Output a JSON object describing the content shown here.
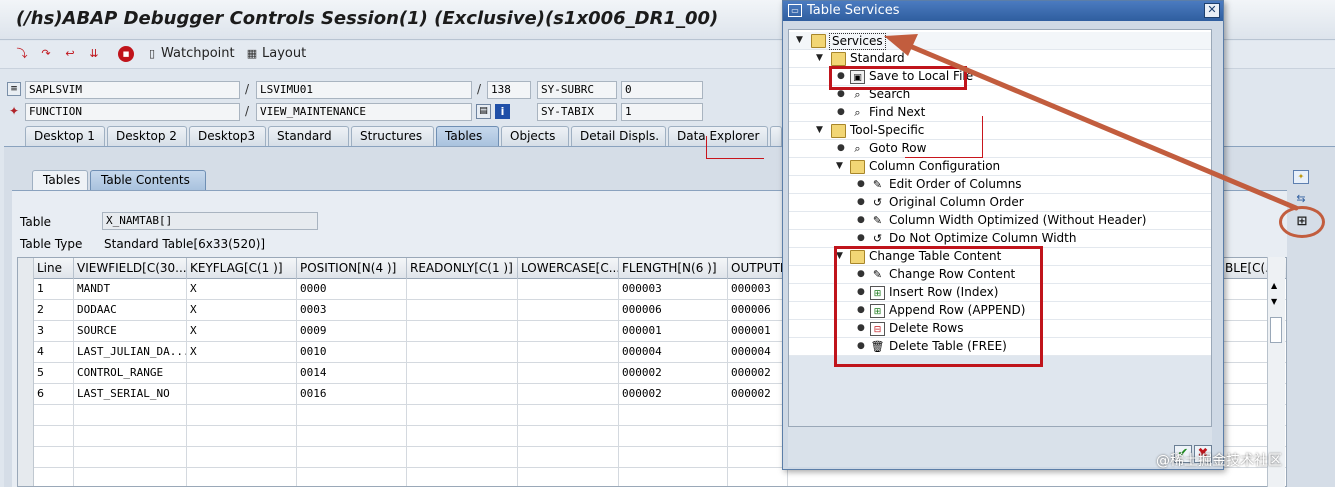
{
  "window": {
    "title": "(/hs)ABAP Debugger Controls Session(1)  (Exclusive)(s1x006_DR1_00)"
  },
  "toolbar": {
    "watchpoint_label": "Watchpoint",
    "layout_label": "Layout"
  },
  "info_fields": {
    "row1": {
      "program": "SAPLSVIM",
      "include": "LSVIMU01",
      "line": "138",
      "sy_label": "SY-SUBRC",
      "sy_value": "0"
    },
    "row2": {
      "type": "FUNCTION",
      "name": "VIEW_MAINTENANCE",
      "sy_label": "SY-TABIX",
      "sy_value": "1"
    }
  },
  "main_tabs": [
    "Desktop 1",
    "Desktop 2",
    "Desktop3",
    "Standard",
    "Structures",
    "Tables",
    "Objects",
    "Detail Displs.",
    "Data Explorer"
  ],
  "sub_tabs": [
    "Tables",
    "Table Contents"
  ],
  "table_info": {
    "table_label": "Table",
    "table_value": "X_NAMTAB[]",
    "type_label": "Table Type",
    "type_value": "Standard Table[6x33(520)]"
  },
  "grid": {
    "columns": [
      "Line",
      "VIEWFIELD[C(30...",
      "KEYFLAG[C(1 )]",
      "POSITION[N(4 )]",
      "READONLY[C(1 )]",
      "LOWERCASE[C...",
      "FLENGTH[N(6 )]",
      "OUTPUTL"
    ],
    "last_column": "BLE[C(...",
    "rows": [
      [
        "1",
        "MANDT",
        "X",
        "0000",
        "",
        "",
        "000003",
        "000003"
      ],
      [
        "2",
        "DODAAC",
        "X",
        "0003",
        "",
        "",
        "000006",
        "000006"
      ],
      [
        "3",
        "SOURCE",
        "X",
        "0009",
        "",
        "",
        "000001",
        "000001"
      ],
      [
        "4",
        "LAST_JULIAN_DA...",
        "X",
        "0010",
        "",
        "",
        "000004",
        "000004"
      ],
      [
        "5",
        "CONTROL_RANGE",
        "",
        "0014",
        "",
        "",
        "000002",
        "000002"
      ],
      [
        "6",
        "LAST_SERIAL_NO",
        "",
        "0016",
        "",
        "",
        "000002",
        "000002"
      ]
    ]
  },
  "dialog": {
    "title": "Table Services",
    "close": "✕",
    "tree": {
      "services": "Services",
      "standard": "Standard",
      "save_local": "Save to Local File",
      "search": "Search",
      "find_next": "Find Next",
      "tool_specific": "Tool-Specific",
      "goto_row": "Goto Row",
      "column_config": "Column Configuration",
      "edit_order": "Edit Order of Columns",
      "original_order": "Original Column Order",
      "width_optimized": "Column Width Optimized (Without Header)",
      "no_optimize": "Do Not Optimize Column Width",
      "change_content": "Change Table Content",
      "change_row": "Change Row Content",
      "insert_row": "Insert Row (Index)",
      "append_row": "Append Row (APPEND)",
      "delete_rows": "Delete Rows",
      "delete_table": "Delete Table (FREE)"
    },
    "ok": "✔",
    "cancel": "✖"
  },
  "watermark": "@稀土掘金技术社区",
  "colors": {
    "annotation_red": "#c0141b",
    "dialog_title": "#2f5e9f",
    "active_tab": "#a9c2de"
  }
}
